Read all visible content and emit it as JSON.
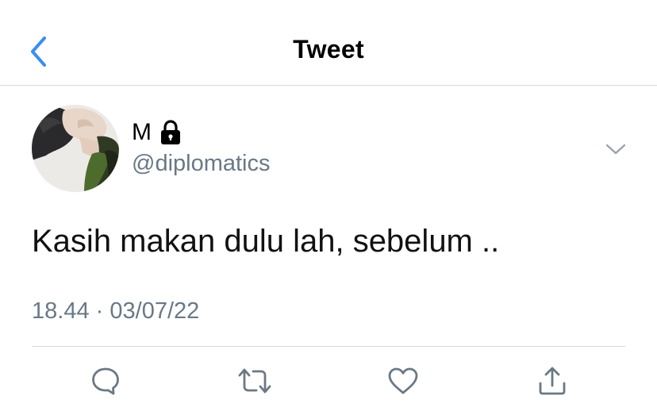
{
  "header": {
    "title": "Tweet",
    "back_icon": "chevron-left-icon"
  },
  "tweet": {
    "user": {
      "display_name": "M",
      "handle": "@diplomatics",
      "protected_icon": "lock-icon"
    },
    "text": "Kasih makan dulu lah, sebelum ..",
    "time": "18.44",
    "separator": "·",
    "date": "03/07/22",
    "menu_icon": "chevron-down-icon",
    "actions": [
      {
        "name": "reply",
        "icon": "reply-icon"
      },
      {
        "name": "retweet",
        "icon": "retweet-icon"
      },
      {
        "name": "like",
        "icon": "heart-icon"
      },
      {
        "name": "share",
        "icon": "share-icon"
      }
    ]
  },
  "colors": {
    "accent": "#3a8ef0",
    "secondary_text": "#697886",
    "divider": "#d9d9d9",
    "icon": "#6b7884"
  }
}
